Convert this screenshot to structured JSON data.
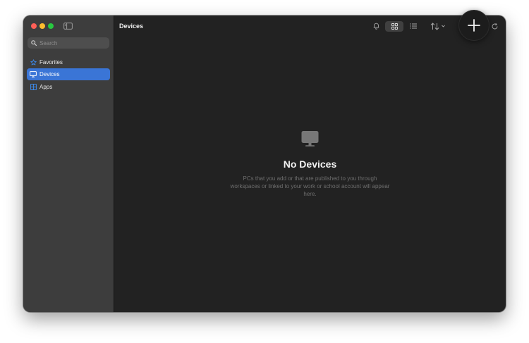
{
  "window": {
    "title": "Devices"
  },
  "sidebar": {
    "search_placeholder": "Search",
    "items": [
      {
        "label": "Favorites",
        "icon": "star-icon",
        "active": false
      },
      {
        "label": "Devices",
        "icon": "monitor-icon",
        "active": true
      },
      {
        "label": "Apps",
        "icon": "apps-grid-icon",
        "active": false
      }
    ]
  },
  "toolbar": {
    "icons": [
      "bell-icon",
      "grid-view-icon",
      "list-view-icon",
      "sort-icon",
      "chevron-down-icon",
      "add-icon",
      "refresh-icon"
    ]
  },
  "empty_state": {
    "icon": "monitor-icon",
    "title": "No Devices",
    "description": "PCs that you add or that are published to you through workspaces or linked to your work or school account will appear here."
  },
  "colors": {
    "accent": "#3a75d6",
    "sidebar_bg": "#3d3d3d",
    "main_bg": "#222222",
    "traffic_red": "#fe5f57",
    "traffic_yellow": "#febc2e",
    "traffic_green": "#28c840"
  }
}
